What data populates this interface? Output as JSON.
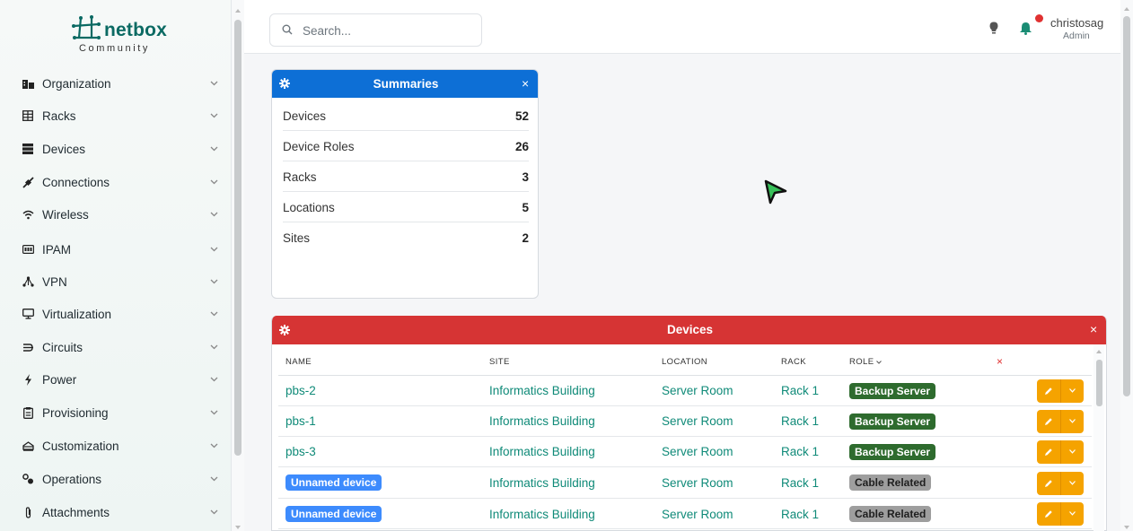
{
  "app": {
    "brand": "netbox",
    "edition": "Community"
  },
  "sidebar": {
    "items": [
      {
        "label": "Organization",
        "icon": "organization-icon"
      },
      {
        "label": "Racks",
        "icon": "racks-icon"
      },
      {
        "label": "Devices",
        "icon": "devices-icon"
      },
      {
        "label": "Connections",
        "icon": "connections-icon"
      },
      {
        "label": "Wireless",
        "icon": "wireless-icon"
      },
      {
        "label": "IPAM",
        "icon": "ipam-icon"
      },
      {
        "label": "VPN",
        "icon": "vpn-icon"
      },
      {
        "label": "Virtualization",
        "icon": "virtualization-icon"
      },
      {
        "label": "Circuits",
        "icon": "circuits-icon"
      },
      {
        "label": "Power",
        "icon": "power-icon"
      },
      {
        "label": "Provisioning",
        "icon": "provisioning-icon"
      },
      {
        "label": "Customization",
        "icon": "customization-icon"
      },
      {
        "label": "Operations",
        "icon": "operations-icon"
      },
      {
        "label": "Attachments",
        "icon": "attachments-icon"
      }
    ]
  },
  "header": {
    "search_placeholder": "Search...",
    "user_name": "christosag",
    "user_role": "Admin"
  },
  "summaries": {
    "title": "Summaries",
    "close": "×",
    "rows": [
      {
        "label": "Devices",
        "value": "52"
      },
      {
        "label": "Device Roles",
        "value": "26"
      },
      {
        "label": "Racks",
        "value": "3"
      },
      {
        "label": "Locations",
        "value": "5"
      },
      {
        "label": "Sites",
        "value": "2"
      }
    ]
  },
  "devices": {
    "title": "Devices",
    "close": "×",
    "columns": {
      "name": "NAME",
      "site": "SITE",
      "location": "LOCATION",
      "rack": "RACK",
      "role": "ROLE",
      "clear": "×"
    },
    "rows": [
      {
        "name": "pbs-2",
        "unnamed": false,
        "site": "Informatics Building",
        "location": "Server Room",
        "rack": "Rack 1",
        "role": "Backup Server",
        "role_color": "#2e6b2e"
      },
      {
        "name": "pbs-1",
        "unnamed": false,
        "site": "Informatics Building",
        "location": "Server Room",
        "rack": "Rack 1",
        "role": "Backup Server",
        "role_color": "#2e6b2e"
      },
      {
        "name": "pbs-3",
        "unnamed": false,
        "site": "Informatics Building",
        "location": "Server Room",
        "rack": "Rack 1",
        "role": "Backup Server",
        "role_color": "#2e6b2e"
      },
      {
        "name": "Unnamed device",
        "unnamed": true,
        "site": "Informatics Building",
        "location": "Server Room",
        "rack": "Rack 1",
        "role": "Cable Related",
        "role_color": "#9e9e9e"
      },
      {
        "name": "Unnamed device",
        "unnamed": true,
        "site": "Informatics Building",
        "location": "Server Room",
        "rack": "Rack 1",
        "role": "Cable Related",
        "role_color": "#9e9e9e"
      }
    ]
  },
  "colors": {
    "brand": "#0b6a63",
    "summaries_header": "#0d6fd6",
    "devices_header": "#d63434",
    "link": "#0f8a78",
    "unnamed_badge": "#3d8bfd",
    "action_button": "#f5a300",
    "notification_dot": "#e03131"
  }
}
